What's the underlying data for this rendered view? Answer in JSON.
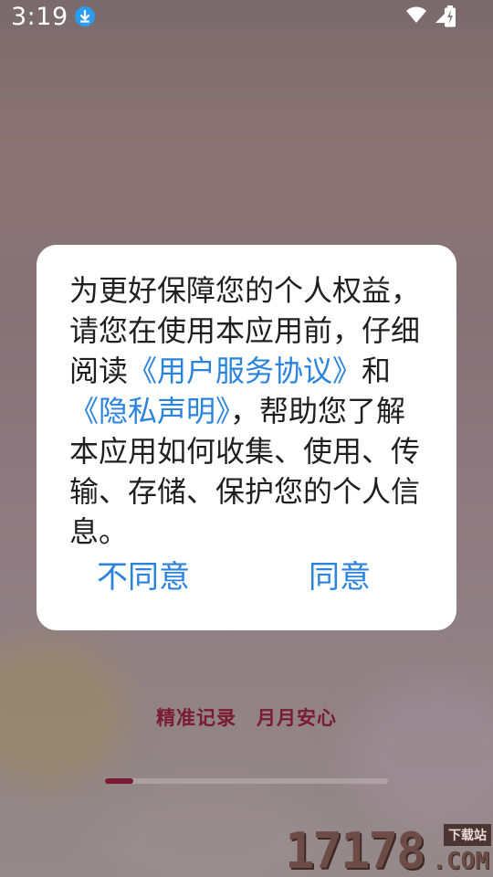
{
  "status_bar": {
    "time": "3:19",
    "icons": [
      "download-icon",
      "wifi-icon",
      "signal-icon",
      "battery-charging-icon"
    ]
  },
  "dialog": {
    "text_before": "为更好保障您的个人权益，请您在使用本应用前，仔细阅读",
    "link_user_agreement": "《用户服务协议》",
    "text_and": "和",
    "link_privacy": "《隐私声明》",
    "text_after": "，帮助您了解本应用如何收集、使用、传输、存储、保护您的个人信息。",
    "disagree_label": "不同意",
    "agree_label": "同意"
  },
  "tagline": "精准记录　月月安心",
  "onboarding": {
    "current_page": 1,
    "total_pages": 10
  },
  "watermark": {
    "number": "17178",
    "badge": "下载站",
    "domain": ".COM"
  },
  "colors": {
    "accent": "#2a83dd",
    "brand": "#7a1a34"
  }
}
